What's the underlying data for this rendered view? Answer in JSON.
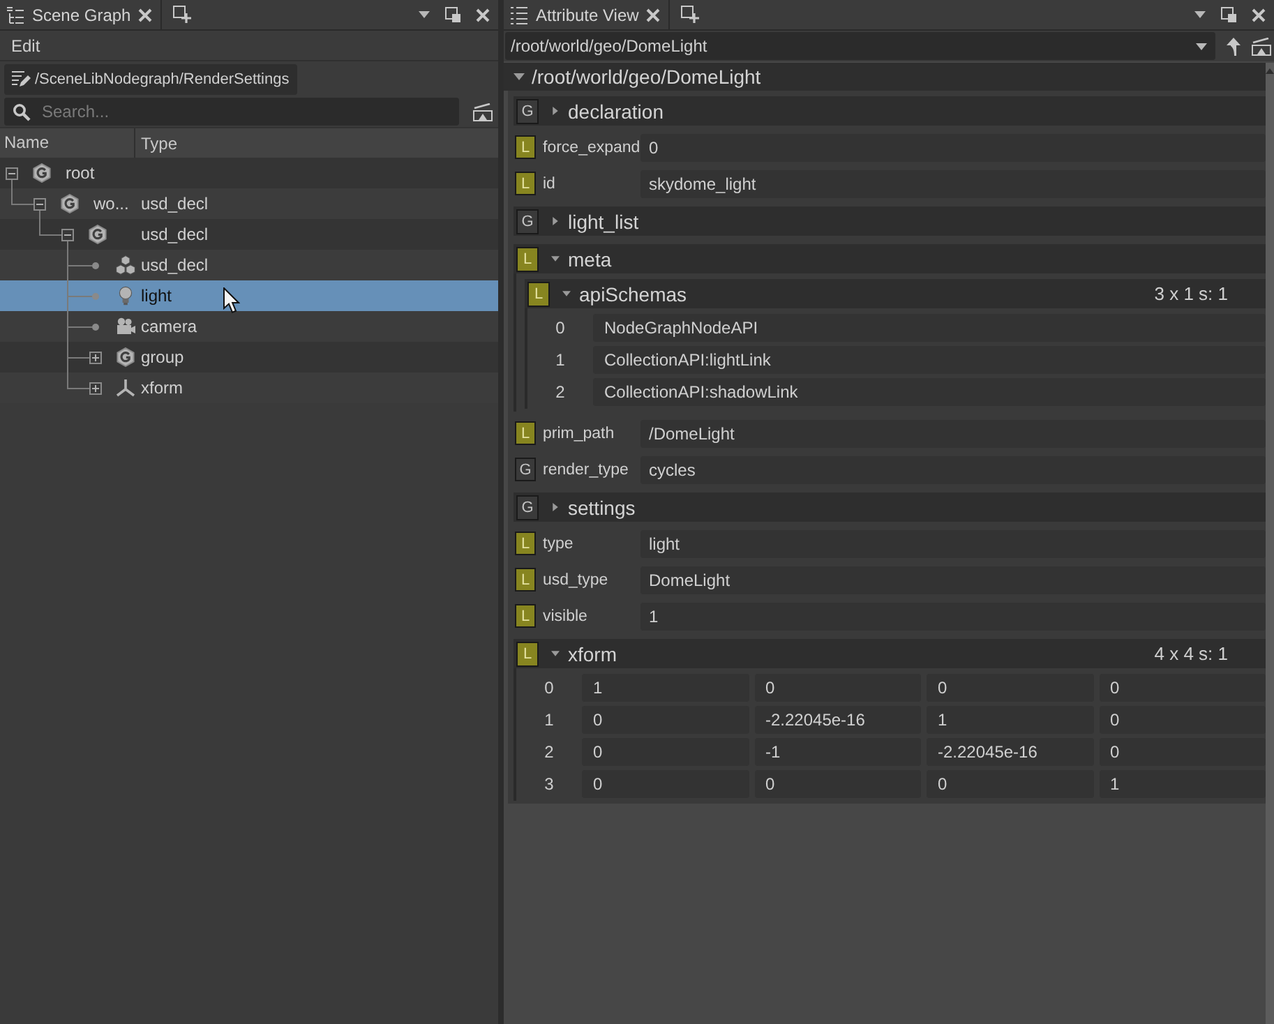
{
  "scene_graph_panel": {
    "tab": {
      "label": "Scene Graph"
    },
    "menu": [
      {
        "label": "Edit"
      }
    ],
    "location": "/SceneLibNodegraph/RenderSettings",
    "search": {
      "placeholder": "Search..."
    },
    "columns": [
      "Name",
      "Type"
    ],
    "tree": [
      {
        "name": "root",
        "kind": "group",
        "expanded": true,
        "selected": false,
        "children": [
          {
            "name": "wo...",
            "type": "usd_decl",
            "kind": "group",
            "expanded": true,
            "selected": false,
            "children": [
              {
                "type": "usd_decl",
                "kind": "group",
                "expanded": true,
                "selected": false,
                "children": [
                  {
                    "type": "usd_decl",
                    "kind": "instances",
                    "selected": false
                  },
                  {
                    "type": "light",
                    "kind": "light",
                    "selected": true
                  },
                  {
                    "type": "camera",
                    "kind": "camera",
                    "selected": false
                  },
                  {
                    "type": "group",
                    "kind": "group",
                    "expanded": false,
                    "selected": false
                  },
                  {
                    "type": "xform",
                    "kind": "xform",
                    "expanded": false,
                    "selected": false
                  }
                ]
              }
            ]
          }
        ]
      }
    ]
  },
  "attribute_view_panel": {
    "tab": {
      "label": "Attribute View"
    },
    "path_combo": {
      "value": "/root/world/geo/DomeLight"
    },
    "location_header": {
      "path": "/root/world/geo/DomeLight",
      "expanded": true
    },
    "attributes": [
      {
        "kind": "group",
        "badge": {
          "letter": "G",
          "kind": "global"
        },
        "label": "declaration",
        "expanded": false
      },
      {
        "kind": "value",
        "badge": {
          "letter": "L",
          "kind": "local"
        },
        "label": "force_expand",
        "value": "0"
      },
      {
        "kind": "value",
        "badge": {
          "letter": "L",
          "kind": "local"
        },
        "label": "id",
        "value": "skydome_light"
      },
      {
        "kind": "group",
        "badge": {
          "letter": "G",
          "kind": "global"
        },
        "label": "light_list",
        "expanded": false
      },
      {
        "kind": "group",
        "badge": {
          "letter": "L",
          "kind": "local"
        },
        "label": "meta",
        "expanded": true,
        "children": [
          {
            "kind": "array",
            "badge": {
              "letter": "L",
              "kind": "local"
            },
            "label": "apiSchemas",
            "expanded": true,
            "size": "3 x 1 s: 1",
            "rows": [
              {
                "index": "0",
                "cells": [
                  "NodeGraphNodeAPI"
                ]
              },
              {
                "index": "1",
                "cells": [
                  "CollectionAPI:lightLink"
                ]
              },
              {
                "index": "2",
                "cells": [
                  "CollectionAPI:shadowLink"
                ]
              }
            ]
          }
        ]
      },
      {
        "kind": "value",
        "badge": {
          "letter": "L",
          "kind": "local"
        },
        "label": "prim_path",
        "value": "/DomeLight"
      },
      {
        "kind": "value",
        "badge": {
          "letter": "G",
          "kind": "global"
        },
        "label": "render_type",
        "value": "cycles"
      },
      {
        "kind": "group",
        "badge": {
          "letter": "G",
          "kind": "global"
        },
        "label": "settings",
        "expanded": false
      },
      {
        "kind": "value",
        "badge": {
          "letter": "L",
          "kind": "local"
        },
        "label": "type",
        "value": "light"
      },
      {
        "kind": "value",
        "badge": {
          "letter": "L",
          "kind": "local"
        },
        "label": "usd_type",
        "value": "DomeLight"
      },
      {
        "kind": "value",
        "badge": {
          "letter": "L",
          "kind": "local"
        },
        "label": "visible",
        "value": "1"
      },
      {
        "kind": "array",
        "badge": {
          "letter": "L",
          "kind": "local"
        },
        "label": "xform",
        "expanded": true,
        "size": "4 x 4 s: 1",
        "rows": [
          {
            "index": "0",
            "cells": [
              "1",
              "0",
              "0",
              "0"
            ]
          },
          {
            "index": "1",
            "cells": [
              "0",
              "-2.22045e-16",
              "1",
              "0"
            ]
          },
          {
            "index": "2",
            "cells": [
              "0",
              "-1",
              "-2.22045e-16",
              "0"
            ]
          },
          {
            "index": "3",
            "cells": [
              "0",
              "0",
              "0",
              "1"
            ]
          }
        ]
      }
    ]
  }
}
